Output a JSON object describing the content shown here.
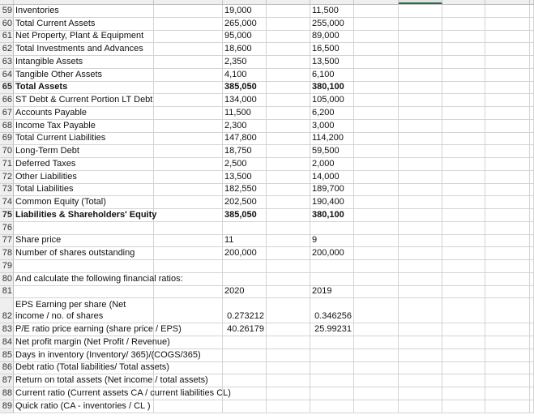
{
  "sheet": {
    "selected_column": "G",
    "accent_color": "#217346",
    "rows": [
      {
        "num": "59",
        "a": "Inventories",
        "c": "19,000",
        "e": "11,500"
      },
      {
        "num": "60",
        "a": "Total Current Assets",
        "c": "265,000",
        "e": "255,000"
      },
      {
        "num": "61",
        "a": "Net Property, Plant & Equipment",
        "c": "95,000",
        "e": "89,000"
      },
      {
        "num": "62",
        "a": "Total Investments and Advances",
        "c": "18,600",
        "e": "16,500"
      },
      {
        "num": "63",
        "a": "Intangible Assets",
        "c": "2,350",
        "e": "13,500"
      },
      {
        "num": "64",
        "a": "Tangible Other Assets",
        "c": "4,100",
        "e": "6,100"
      },
      {
        "num": "65",
        "a": "Total Assets",
        "c": "385,050",
        "e": "380,100",
        "bold": true
      },
      {
        "num": "66",
        "a": "ST Debt & Current Portion LT Debt",
        "c": "134,000",
        "e": "105,000"
      },
      {
        "num": "67",
        "a": "Accounts Payable",
        "c": "11,500",
        "e": "6,200"
      },
      {
        "num": "68",
        "a": "Income Tax Payable",
        "c": "2,300",
        "e": "3,000"
      },
      {
        "num": "69",
        "a": "Total Current Liabilities",
        "c": "147,800",
        "e": "114,200"
      },
      {
        "num": "70",
        "a": "Long-Term Debt",
        "c": "18,750",
        "e": "59,500"
      },
      {
        "num": "71",
        "a": "Deferred Taxes",
        "c": "2,500",
        "e": "2,000"
      },
      {
        "num": "72",
        "a": "Other Liabilities",
        "c": "13,500",
        "e": "14,000"
      },
      {
        "num": "73",
        "a": "Total Liabilities",
        "c": "182,550",
        "e": "189,700"
      },
      {
        "num": "74",
        "a": "Common Equity (Total)",
        "c": "202,500",
        "e": "190,400"
      },
      {
        "num": "75",
        "a": "Liabilities & Shareholders' Equity",
        "c": "385,050",
        "e": "380,100",
        "bold": true
      },
      {
        "num": "76",
        "a": "",
        "c": "",
        "e": ""
      },
      {
        "num": "77",
        "a": "Share price",
        "c": "11",
        "e": "9"
      },
      {
        "num": "78",
        "a": "Number of shares outstanding",
        "c": "200,000",
        "e": "200,000"
      },
      {
        "num": "79",
        "a": "",
        "c": "",
        "e": ""
      },
      {
        "num": "80",
        "a": "And calculate the following financial ratios:",
        "c": "",
        "e": ""
      },
      {
        "num": "81",
        "a": "",
        "c": "2020",
        "e": "2019"
      },
      {
        "num": "82",
        "a": "EPS Earning per share (Net income / no. of shares",
        "c": "0.273212",
        "e": "0.346256",
        "numeric": true,
        "tall": true
      },
      {
        "num": "83",
        "a": "P/E ratio price earning (share price / EPS)",
        "c": "40.26179",
        "e": "25.99231",
        "numeric": true
      },
      {
        "num": "84",
        "a": "Net profit margin (Net Profit / Revenue)",
        "c": "",
        "e": ""
      },
      {
        "num": "85",
        "a": "Days in inventory (Inventory/ 365)/(COGS/365)",
        "c": "",
        "e": ""
      },
      {
        "num": "86",
        "a": "Debt ratio (Total liabilities/ Total assets)",
        "c": "",
        "e": ""
      },
      {
        "num": "87",
        "a": "Return on total assets (Net income / total assets)",
        "c": "",
        "e": ""
      },
      {
        "num": "88",
        "a": "Current ratio (Current assets CA / current liabilities CL)",
        "c": "",
        "e": ""
      },
      {
        "num": "89",
        "a": "Quick ratio (CA - inventories / CL )",
        "c": "",
        "e": ""
      }
    ]
  }
}
